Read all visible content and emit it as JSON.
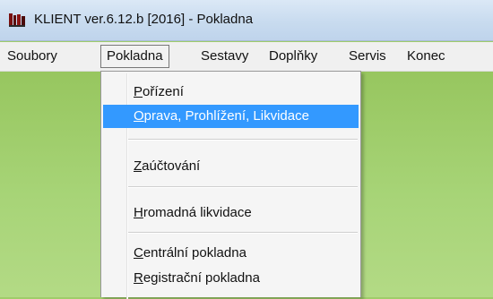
{
  "window": {
    "title": "KLIENT ver.6.12.b [2016] - Pokladna"
  },
  "menubar": {
    "items": [
      {
        "label": "Soubory"
      },
      {
        "label": "Pokladna"
      },
      {
        "label": "Sestavy"
      },
      {
        "label": "Doplňky"
      },
      {
        "label": "Servis"
      },
      {
        "label": "Konec"
      }
    ],
    "open_menu": "Pokladna"
  },
  "dropdown": {
    "items": [
      {
        "accel": "P",
        "rest": "ořízení"
      },
      {
        "accel": "O",
        "rest": "prava, Prohlížení, Likvidace",
        "highlighted": true
      },
      {
        "accel": "Z",
        "rest": "aúčtování"
      },
      {
        "accel": "H",
        "rest": "romadná likvidace"
      },
      {
        "accel": "C",
        "rest": "entrální pokladna"
      },
      {
        "accel": "R",
        "rest": "egistrační pokladna"
      }
    ]
  },
  "colors": {
    "highlight": "#3399ff",
    "background_green": "#9fcc6a",
    "titlebar": "#c8dbef",
    "app_icon": "#7a1010"
  },
  "icons": {
    "app": "books-icon"
  }
}
